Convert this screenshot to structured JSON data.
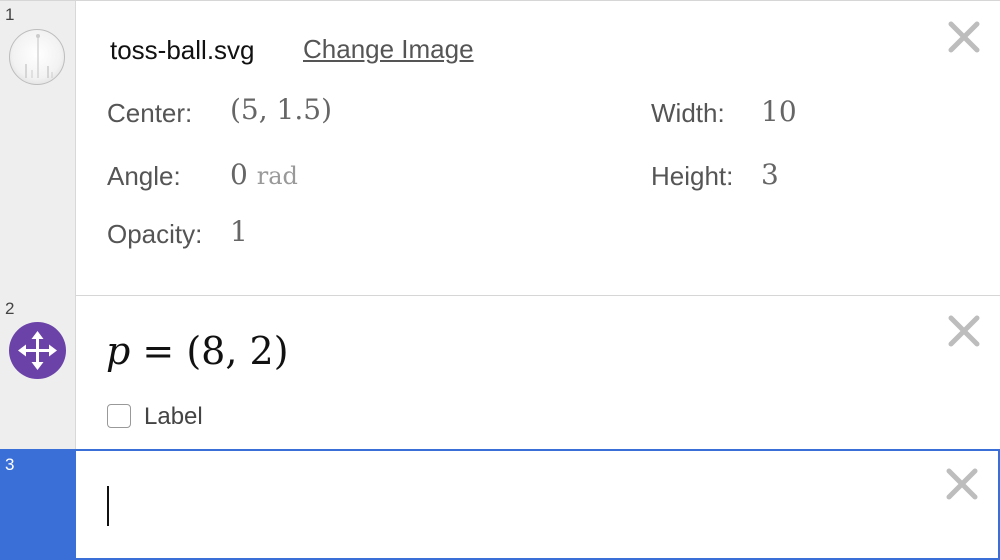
{
  "expressions": [
    {
      "number": "1",
      "type": "image",
      "filename": "toss-ball.svg",
      "change_label": "Change Image",
      "fields": {
        "center_label": "Center:",
        "center_value": "(5, 1.5)",
        "width_label": "Width:",
        "width_value": "10",
        "angle_label": "Angle:",
        "angle_value": "0",
        "angle_unit": "rad",
        "height_label": "Height:",
        "height_value": "3",
        "opacity_label": "Opacity:",
        "opacity_value": "1"
      },
      "icons": {
        "thumbnail": "image-thumbnail",
        "delete": "close-icon"
      }
    },
    {
      "number": "2",
      "type": "point",
      "var": "p",
      "equals": "=",
      "value": "(8, 2)",
      "label_text": "Label",
      "label_checked": false,
      "icons": {
        "point": "move-arrows-icon",
        "delete": "close-icon"
      },
      "icon_color": "#6a42a8"
    },
    {
      "number": "3",
      "type": "empty",
      "active": true,
      "input_value": "",
      "accent_color": "#3b6fd8",
      "icons": {
        "delete": "close-icon"
      }
    }
  ]
}
